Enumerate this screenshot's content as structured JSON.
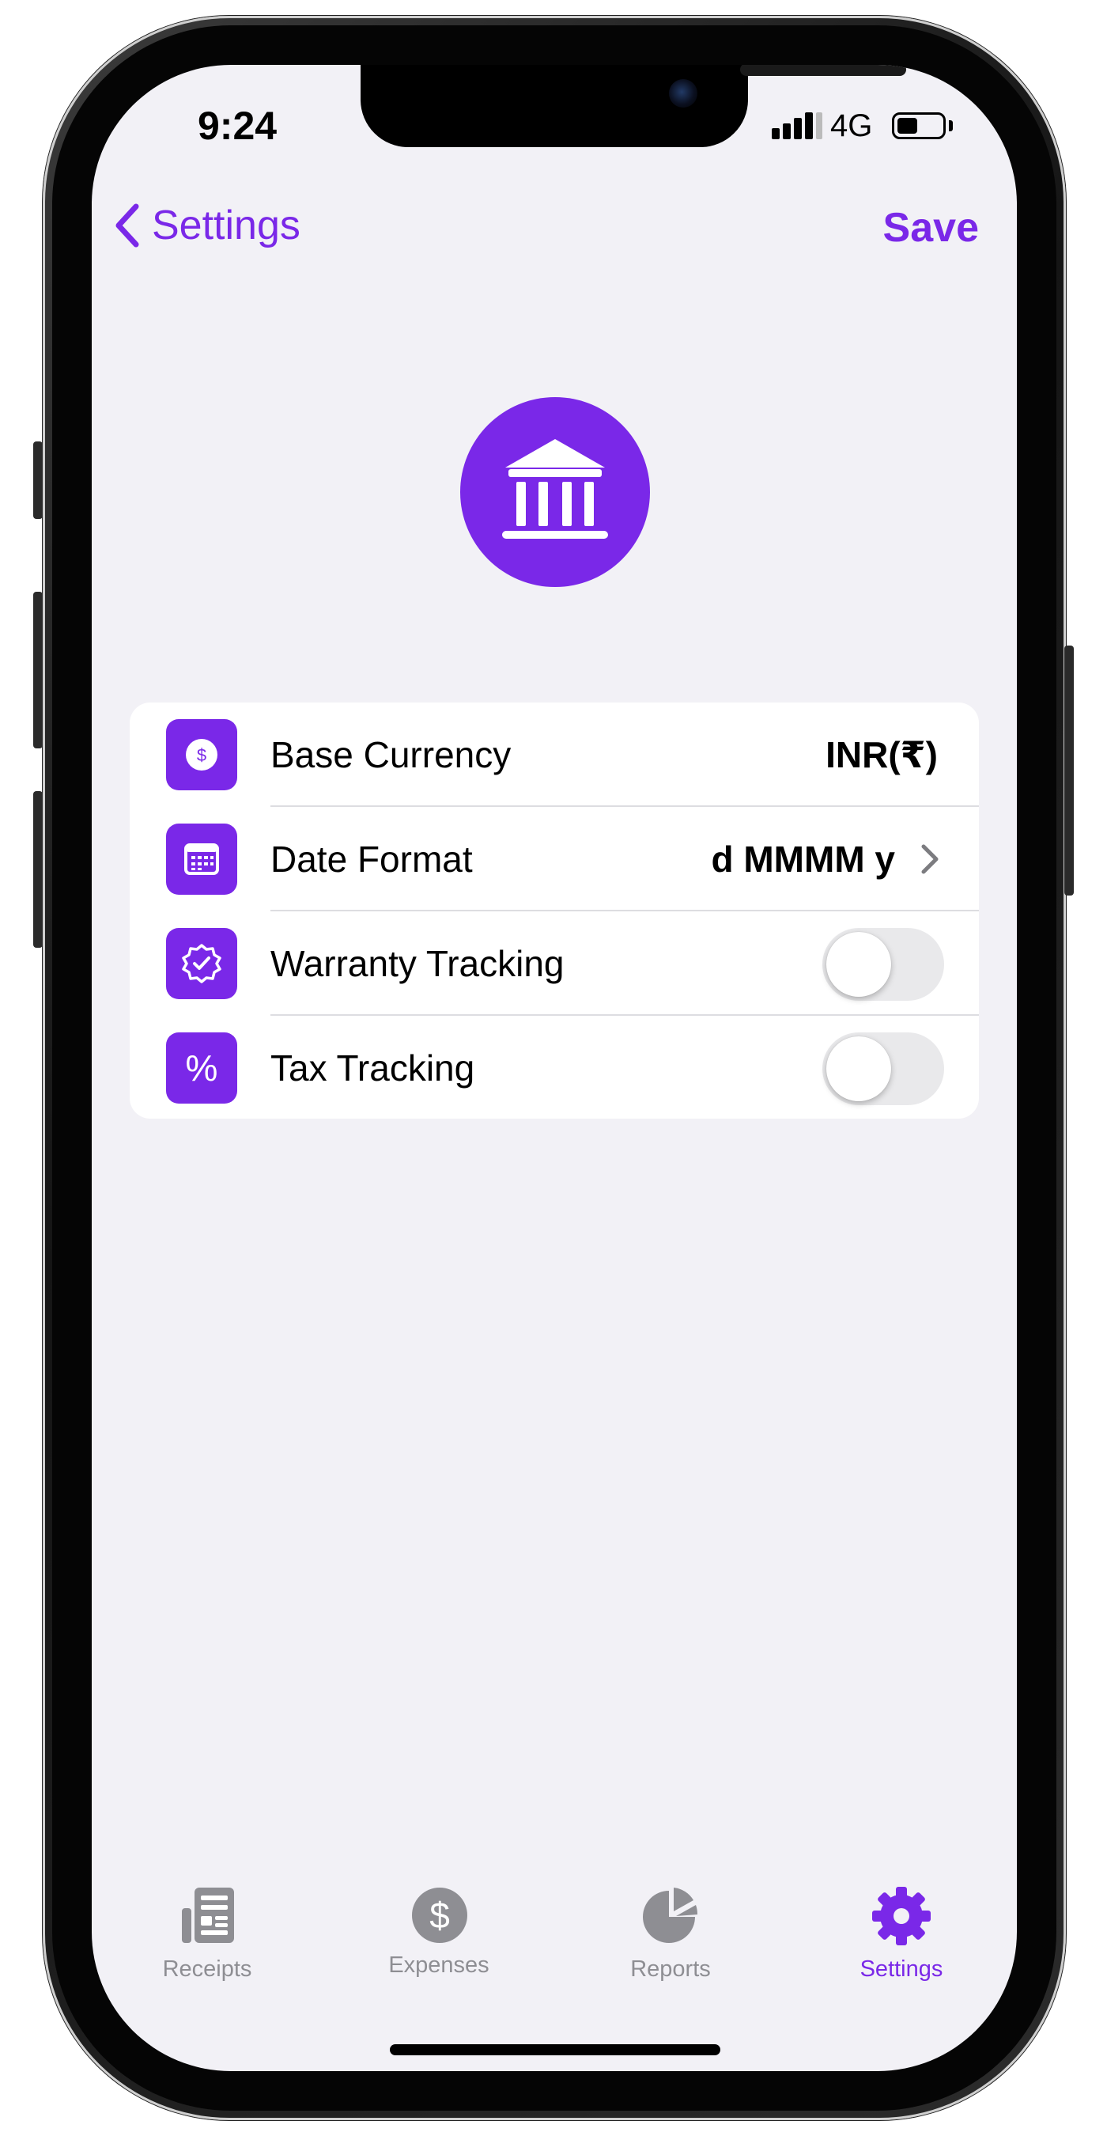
{
  "status_bar": {
    "time": "9:24",
    "network": "4G",
    "signal_icon": "signal-bars-icon",
    "battery_icon": "battery-icon",
    "battery_level": 0.45
  },
  "nav": {
    "back_label": "Settings",
    "back_icon": "chevron-left-icon",
    "save_label": "Save"
  },
  "header": {
    "icon": "bank-icon"
  },
  "settings": {
    "rows": [
      {
        "label": "Base Currency",
        "value": "INR(₹)",
        "icon": "dollar-circle-icon",
        "control": "value"
      },
      {
        "label": "Date Format",
        "value": "d MMMM y",
        "icon": "calendar-icon",
        "control": "disclosure"
      },
      {
        "label": "Warranty Tracking",
        "icon": "checkmark-seal-icon",
        "control": "toggle",
        "on": false
      },
      {
        "label": "Tax Tracking",
        "icon": "percent-icon",
        "glyph": "%",
        "control": "toggle",
        "on": false
      }
    ]
  },
  "tab_bar": {
    "tabs": [
      {
        "label": "Receipts",
        "icon": "receipts-icon",
        "active": false
      },
      {
        "label": "Expenses",
        "icon": "dollar-circle-icon",
        "glyph": "$",
        "active": false
      },
      {
        "label": "Reports",
        "icon": "pie-chart-icon",
        "active": false
      },
      {
        "label": "Settings",
        "icon": "gear-icon",
        "active": true
      }
    ]
  },
  "colors": {
    "accent": "#7a28e8",
    "background": "#f2f1f6",
    "inactive_tab": "#8e8e93",
    "toggle_off": "#e9e9eb"
  }
}
